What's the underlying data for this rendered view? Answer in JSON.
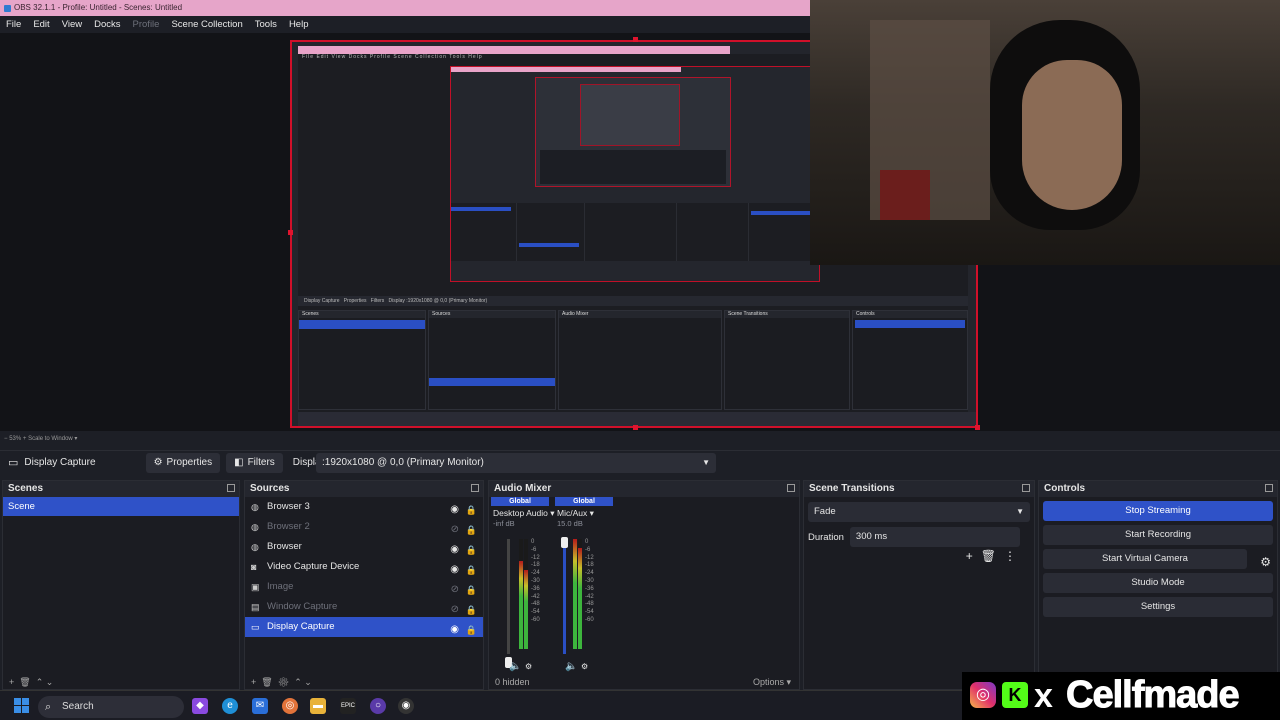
{
  "window": {
    "title": "OBS 32.1.1 - Profile: Untitled - Scenes: Untitled"
  },
  "menu": {
    "file": "File",
    "edit": "Edit",
    "view": "View",
    "docks": "Docks",
    "profile": "Profile",
    "scene_collection": "Scene Collection",
    "tools": "Tools",
    "help": "Help"
  },
  "preview_status": {
    "zoom": "53%",
    "scale": "Scale to Window"
  },
  "source_toolbar": {
    "current_source": "Display Capture",
    "properties": "Properties",
    "filters": "Filters",
    "display_label": "Display",
    "display_value": ":1920x1080 @ 0,0 (Primary Monitor)"
  },
  "scenes": {
    "title": "Scenes",
    "items": [
      "Scene"
    ]
  },
  "sources": {
    "title": "Sources",
    "items": [
      {
        "name": "Browser 3",
        "icon": "globe-icon",
        "visible": true
      },
      {
        "name": "Browser 2",
        "icon": "globe-icon",
        "visible": false
      },
      {
        "name": "Browser",
        "icon": "globe-icon",
        "visible": true
      },
      {
        "name": "Video Capture Device",
        "icon": "camera-icon",
        "visible": true
      },
      {
        "name": "Image",
        "icon": "image-icon",
        "visible": false
      },
      {
        "name": "Window Capture",
        "icon": "window-icon",
        "visible": false
      },
      {
        "name": "Display Capture",
        "icon": "monitor-icon",
        "visible": true,
        "selected": true
      }
    ]
  },
  "mixer": {
    "title": "Audio Mixer",
    "channels": [
      {
        "tag": "Global",
        "name": "Desktop Audio",
        "db": "-inf dB"
      },
      {
        "tag": "Global",
        "name": "Mic/Aux",
        "db": "15.0 dB"
      }
    ],
    "scale": [
      "0",
      "-6",
      "-12",
      "-18",
      "-24",
      "-30",
      "-36",
      "-42",
      "-48",
      "-54",
      "-60"
    ],
    "hidden_label": "0 hidden",
    "options_label": "Options"
  },
  "transitions": {
    "title": "Scene Transitions",
    "selected": "Fade",
    "duration_label": "Duration",
    "duration_value": "300 ms"
  },
  "controls": {
    "title": "Controls",
    "stop_streaming": "Stop Streaming",
    "start_recording": "Start Recording",
    "start_virtual_camera": "Start Virtual Camera",
    "studio_mode": "Studio Mode",
    "settings": "Settings"
  },
  "taskbar": {
    "search": "Search"
  },
  "brand": {
    "name": "Cellfmade"
  },
  "colors": {
    "accent": "#2f52c8",
    "titlebar": "#e6a5c9",
    "red_border": "#d0102a"
  }
}
